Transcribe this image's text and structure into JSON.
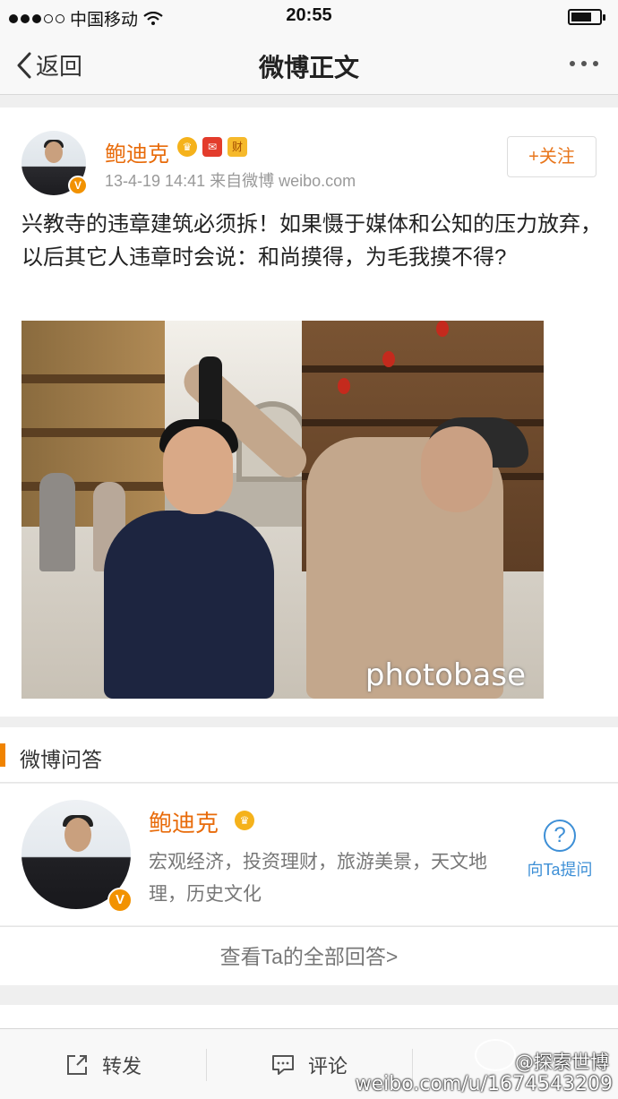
{
  "status_bar": {
    "carrier": "中国移动",
    "time": "20:55"
  },
  "nav": {
    "back_label": "返回",
    "title": "微博正文"
  },
  "post": {
    "author": "鲍迪克",
    "timestamp": "13-4-19 14:41",
    "source": "来自微博 weibo.com",
    "follow_label": "+关注",
    "text": "兴教寺的违章建筑必须拆！如果慑于媒体和公知的压力放弃，以后其它人违章时会说：和尚摸得，为毛我摸不得?",
    "badge_cai": "财",
    "photo_watermark": "photobase"
  },
  "qa": {
    "section_title": "微博问答",
    "name": "鲍迪克",
    "tags": "宏观经济，投资理财，旅游美景，天文地理，历史文化",
    "ask_label": "向Ta提问",
    "view_all": "查看Ta的全部回答>"
  },
  "toolbar": {
    "repost": "转发",
    "comment": "评论"
  },
  "watermark": {
    "user": "@探索世博",
    "url": "weibo.com/u/1674543209"
  },
  "colors": {
    "accent_orange": "#e86b0a",
    "qa_bar": "#f08300",
    "ask_blue": "#3d8fd6"
  }
}
